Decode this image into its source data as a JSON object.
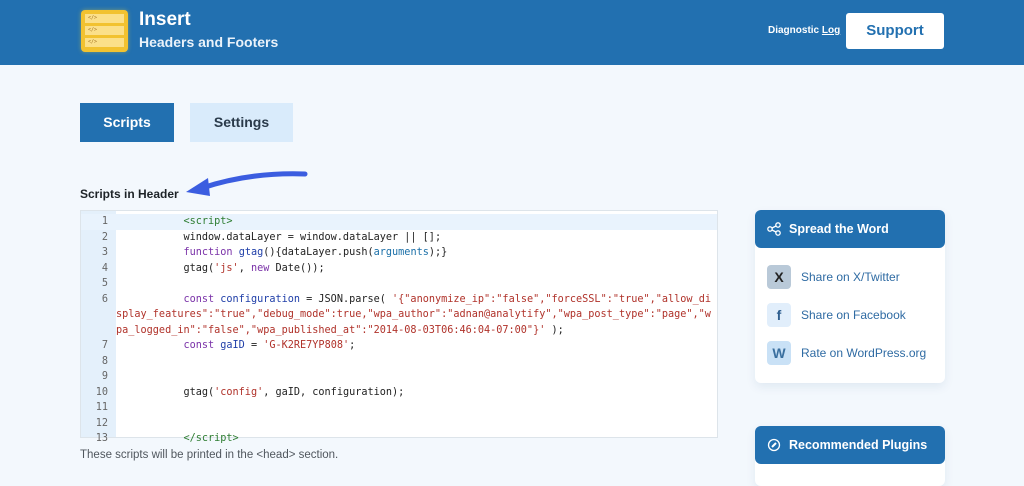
{
  "header": {
    "brand_line1": "Insert",
    "brand_line2": "Headers and Footers",
    "diagnostic": "Diagnostic",
    "log": "Log",
    "support": "Support",
    "logo_marks": [
      "</>",
      "</>",
      "</>"
    ]
  },
  "tabs": [
    {
      "label": "Scripts",
      "active": true
    },
    {
      "label": "Settings",
      "active": false
    }
  ],
  "section_title": "Scripts in Header",
  "editor": {
    "lines": [
      {
        "n": "1",
        "tokens": [
          [
            "tg",
            "           <script>"
          ]
        ]
      },
      {
        "n": "2",
        "tokens": [
          [
            "",
            "           window.dataLayer = window.dataLayer || [];"
          ]
        ]
      },
      {
        "n": "3",
        "tokens": [
          [
            "",
            "           "
          ],
          [
            "kw",
            "function"
          ],
          [
            "",
            " "
          ],
          [
            "vr",
            "gtag"
          ],
          [
            "",
            "(){dataLayer.push("
          ],
          [
            "bi",
            "arguments"
          ],
          [
            "",
            ");}"
          ]
        ]
      },
      {
        "n": "4",
        "tokens": [
          [
            "",
            "           gtag("
          ],
          [
            "st",
            "'js'"
          ],
          [
            "",
            ", "
          ],
          [
            "kw",
            "new"
          ],
          [
            "",
            " Date());"
          ]
        ]
      },
      {
        "n": "5",
        "tokens": [
          [
            "",
            ""
          ]
        ]
      },
      {
        "n": "6",
        "tokens": [
          [
            "",
            "           "
          ],
          [
            "kw",
            "const"
          ],
          [
            "",
            " "
          ],
          [
            "vr",
            "configuration"
          ],
          [
            "",
            " = JSON.parse( "
          ],
          [
            "st",
            "'{\"anonymize_ip\":\"false\",\"forceSSL\":\"true\",\"allow_display_features\":\"true\",\"debug_mode\":true,\"wpa_author\":\"adnan@analytify\",\"wpa_post_type\":\"page\",\"wpa_logged_in\":\"false\",\"wpa_published_at\":\"2014-08-03T06:46:04-07:00\"}'"
          ],
          [
            "",
            " );"
          ]
        ]
      },
      {
        "n": "7",
        "tokens": [
          [
            "",
            "           "
          ],
          [
            "kw",
            "const"
          ],
          [
            "",
            " "
          ],
          [
            "vr",
            "gaID"
          ],
          [
            "",
            " = "
          ],
          [
            "st",
            "'G-K2RE7YP808'"
          ],
          [
            "",
            ";"
          ]
        ]
      },
      {
        "n": "8",
        "tokens": [
          [
            "",
            ""
          ]
        ]
      },
      {
        "n": "9",
        "tokens": [
          [
            "",
            ""
          ]
        ]
      },
      {
        "n": "10",
        "tokens": [
          [
            "",
            "           gtag("
          ],
          [
            "st",
            "'config'"
          ],
          [
            "",
            ", gaID, configuration);"
          ]
        ]
      },
      {
        "n": "11",
        "tokens": [
          [
            "",
            ""
          ]
        ]
      },
      {
        "n": "12",
        "tokens": [
          [
            "",
            ""
          ]
        ]
      },
      {
        "n": "13",
        "tokens": [
          [
            "tg",
            "           </script>"
          ]
        ]
      }
    ]
  },
  "note": "These scripts will be printed in the <head> section.",
  "sidebar": {
    "spread": {
      "title": "Spread the Word",
      "items": [
        {
          "label": "Share on X/Twitter",
          "icon": "X"
        },
        {
          "label": "Share on Facebook",
          "icon": "f"
        },
        {
          "label": "Rate on WordPress.org",
          "icon": "W"
        }
      ]
    },
    "recommended": {
      "title": "Recommended Plugins"
    }
  },
  "colors": {
    "brand": "#2270b0",
    "tab_inactive": "#d9ebfb",
    "background": "#f3f8fd"
  }
}
